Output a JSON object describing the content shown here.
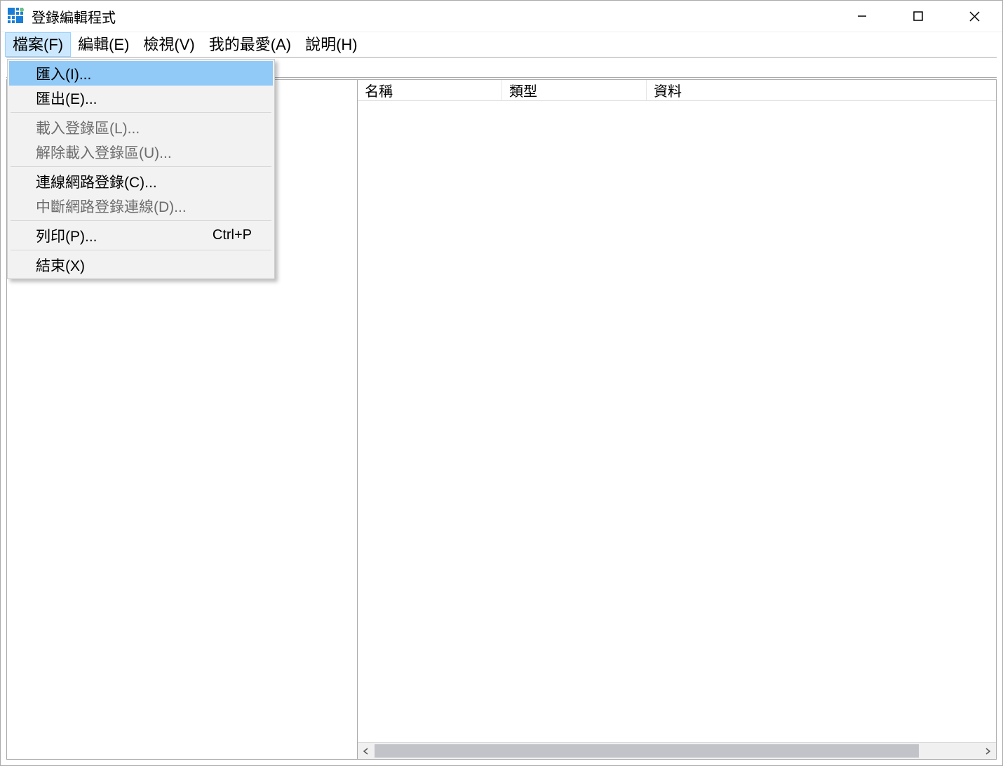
{
  "titlebar": {
    "title": "登錄編輯程式"
  },
  "menubar": {
    "items": [
      {
        "label": "檔案(F)",
        "open": true
      },
      {
        "label": "編輯(E)",
        "open": false
      },
      {
        "label": "檢視(V)",
        "open": false
      },
      {
        "label": "我的最愛(A)",
        "open": false
      },
      {
        "label": "說明(H)",
        "open": false
      }
    ]
  },
  "dropdown": {
    "items": [
      {
        "label": "匯入(I)...",
        "enabled": true,
        "highlighted": true,
        "shortcut": ""
      },
      {
        "label": "匯出(E)...",
        "enabled": true,
        "highlighted": false,
        "shortcut": ""
      },
      {
        "sep": true
      },
      {
        "label": "載入登錄區(L)...",
        "enabled": false,
        "highlighted": false,
        "shortcut": ""
      },
      {
        "label": "解除載入登錄區(U)...",
        "enabled": false,
        "highlighted": false,
        "shortcut": ""
      },
      {
        "sep": true
      },
      {
        "label": "連線網路登錄(C)...",
        "enabled": true,
        "highlighted": false,
        "shortcut": ""
      },
      {
        "label": "中斷網路登錄連線(D)...",
        "enabled": false,
        "highlighted": false,
        "shortcut": ""
      },
      {
        "sep": true
      },
      {
        "label": "列印(P)...",
        "enabled": true,
        "highlighted": false,
        "shortcut": "Ctrl+P"
      },
      {
        "sep": true
      },
      {
        "label": "結束(X)",
        "enabled": true,
        "highlighted": false,
        "shortcut": ""
      }
    ]
  },
  "list": {
    "columns": {
      "name": "名稱",
      "type": "類型",
      "data": "資料"
    }
  }
}
